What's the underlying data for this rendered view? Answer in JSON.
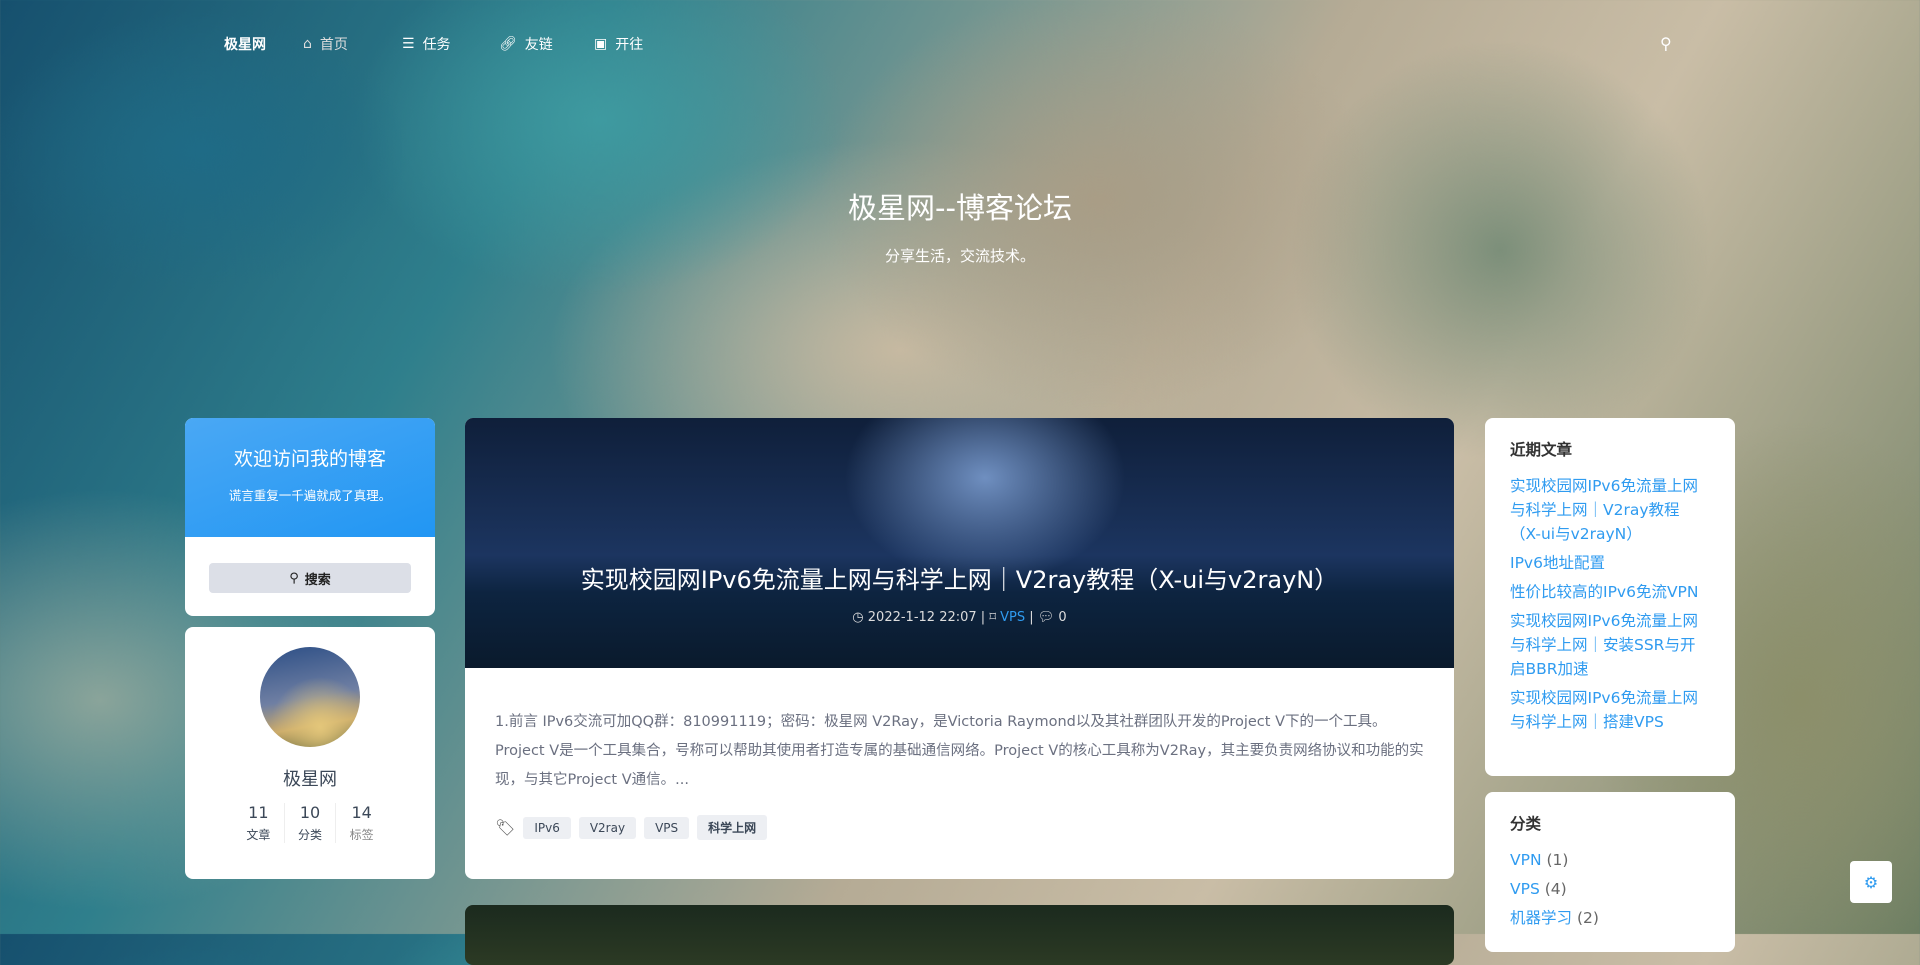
{
  "nav": {
    "brand": "极星网",
    "items": [
      {
        "label": "首页",
        "icon": "home-icon"
      },
      {
        "label": "任务",
        "icon": "list-icon"
      },
      {
        "label": "友链",
        "icon": "link-icon"
      },
      {
        "label": "开往",
        "icon": "train-icon"
      }
    ]
  },
  "hero": {
    "title": "极星网--博客论坛",
    "subtitle": "分享生活，交流技术。"
  },
  "welcome": {
    "title": "欢迎访问我的博客",
    "motto": "谎言重复一千遍就成了真理。",
    "search_label": "搜索"
  },
  "profile": {
    "name": "极星网",
    "stats": [
      {
        "value": "11",
        "label": "文章"
      },
      {
        "value": "10",
        "label": "分类"
      },
      {
        "value": "14",
        "label": "标签"
      }
    ]
  },
  "post": {
    "title": "实现校园网IPv6免流量上网与科学上网｜V2ray教程（X-ui与v2rayN）",
    "date": "2022-1-12 22:07",
    "category": "VPS",
    "comments": "0",
    "excerpt": "1.前言 IPv6交流可加QQ群：810991119；密码：极星网 V2Ray，是Victoria Raymond以及其社群团队开发的Project V下的一个工具。Project V是一个工具集合，号称可以帮助其使用者打造专属的基础通信网络。Project V的核心工具称为V2Ray，其主要负责网络协议和功能的实现，与其它Project V通信。...",
    "tags": [
      "IPv6",
      "V2ray",
      "VPS",
      "科学上网"
    ]
  },
  "recent": {
    "title": "近期文章",
    "items": [
      "实现校园网IPv6免流量上网与科学上网｜V2ray教程（X-ui与v2rayN）",
      "IPv6地址配置",
      "性价比较高的IPv6免流VPN",
      "实现校园网IPv6免流量上网与科学上网｜安装SSR与开启BBR加速",
      "实现校园网IPv6免流量上网与科学上网｜搭建VPS"
    ]
  },
  "categories": {
    "title": "分类",
    "items": [
      {
        "name": "VPN",
        "count": "(1)"
      },
      {
        "name": "VPS",
        "count": "(4)"
      },
      {
        "name": "机器学习",
        "count": "(2)"
      }
    ]
  },
  "colors": {
    "accent": "#2f9bf0",
    "welcome_bg": "#2196f3"
  }
}
